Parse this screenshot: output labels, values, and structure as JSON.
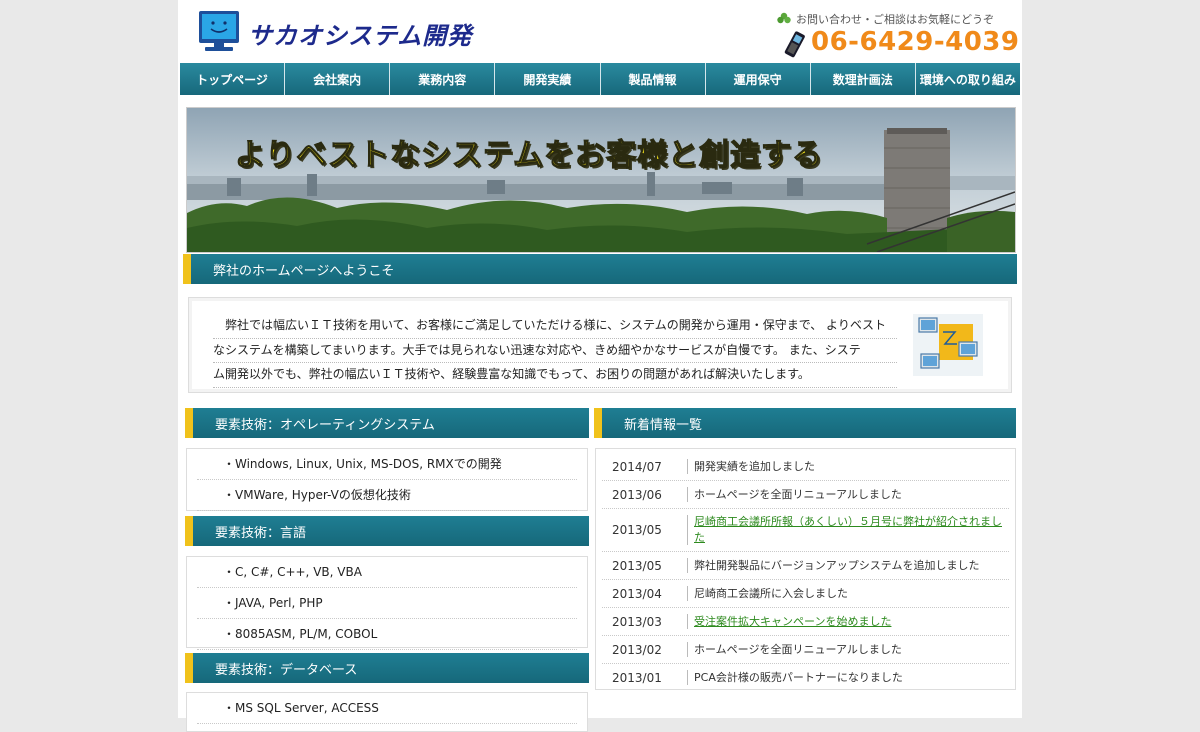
{
  "header": {
    "site_title": "サカオシステム開発",
    "contact_note": "お問い合わせ・ご相談はお気軽にどうぞ",
    "phone": "06-6429-4039"
  },
  "nav": {
    "items": [
      {
        "label": "トップページ"
      },
      {
        "label": "会社案内"
      },
      {
        "label": "業務内容"
      },
      {
        "label": "開発実績"
      },
      {
        "label": "製品情報"
      },
      {
        "label": "運用保守"
      },
      {
        "label": "数理計画法"
      },
      {
        "label": "環境への取り組み"
      }
    ]
  },
  "hero": {
    "headline": "よりベストなシステムをお客様と創造する"
  },
  "welcome": {
    "heading": "弊社のホームページへようこそ",
    "lines": [
      "　弊社では幅広いＩＴ技術を用いて、お客様にご満足していただける様に、システムの開発から運用・保守まで、 よりベスト",
      "なシステムを構築してまいります。大手では見られない迅速な対応や、きめ細やかなサービスが自慢です。 また、システ",
      "ム開発以外でも、弊社の幅広いＩＴ技術や、経験豊富な知識でもって、お困りの問題があれば解決いたします。"
    ]
  },
  "tech": {
    "os": {
      "heading": "要素技術：オペレーティングシステム",
      "items": [
        "・Windows, Linux, Unix, MS-DOS, RMXでの開発",
        "・VMWare, Hyper-Vの仮想化技術"
      ]
    },
    "lang": {
      "heading": "要素技術：言語",
      "items": [
        "・C, C#, C++, VB, VBA",
        "・JAVA, Perl, PHP",
        "・8085ASM, PL/M, COBOL"
      ]
    },
    "db": {
      "heading": "要素技術：データベース",
      "items": [
        "・MS SQL Server, ACCESS"
      ]
    }
  },
  "news": {
    "heading": "新着情報一覧",
    "rows": [
      {
        "date": "2014/07",
        "text": "開発実績を追加しました",
        "link": false
      },
      {
        "date": "2013/06",
        "text": "ホームページを全面リニューアルしました",
        "link": false
      },
      {
        "date": "2013/05",
        "text": "尼崎商工会議所所報（あくしい）５月号に弊社が紹介されました",
        "link": true
      },
      {
        "date": "2013/05",
        "text": "弊社開発製品にバージョンアップシステムを追加しました",
        "link": false
      },
      {
        "date": "2013/04",
        "text": "尼崎商工会議所に入会しました",
        "link": false
      },
      {
        "date": "2013/03",
        "text": "受注案件拡大キャンペーンを始めました",
        "link": true
      },
      {
        "date": "2013/02",
        "text": "ホームページを全面リニューアルしました",
        "link": false
      },
      {
        "date": "2013/01",
        "text": "PCA会計様の販売パートナーになりました",
        "link": false
      }
    ]
  },
  "colors": {
    "nav_bg": "#1e6f82",
    "accent_yellow": "#f0c21b",
    "phone_orange": "#f08a1a",
    "title_blue": "#1d2a8c",
    "link_green": "#2d8a1e"
  }
}
